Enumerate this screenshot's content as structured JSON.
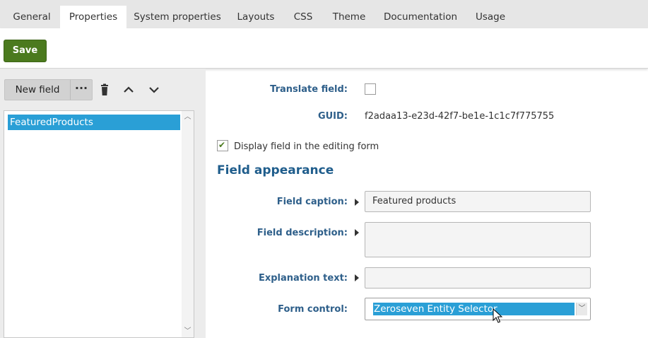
{
  "tabs": [
    {
      "label": "General",
      "active": false
    },
    {
      "label": "Properties",
      "active": true
    },
    {
      "label": "System properties",
      "active": false
    },
    {
      "label": "Layouts",
      "active": false
    },
    {
      "label": "CSS",
      "active": false
    },
    {
      "label": "Theme",
      "active": false
    },
    {
      "label": "Documentation",
      "active": false
    },
    {
      "label": "Usage",
      "active": false
    }
  ],
  "actions": {
    "save_label": "Save"
  },
  "left_panel": {
    "new_field_label": "New field",
    "more_label": "···",
    "fields": [
      {
        "name": "FeaturedProducts",
        "selected": true
      }
    ]
  },
  "form": {
    "translate_field": {
      "label": "Translate field:",
      "checked": false
    },
    "guid": {
      "label": "GUID:",
      "value": "f2adaa13-e23d-42f7-be1e-1c1c7f775755"
    },
    "display_field": {
      "label": "Display field in the editing form",
      "checked": true
    },
    "section_title": "Field appearance",
    "field_caption": {
      "label": "Field caption:",
      "value": "Featured products"
    },
    "field_description": {
      "label": "Field description:",
      "value": ""
    },
    "explanation_text": {
      "label": "Explanation text:",
      "value": ""
    },
    "form_control": {
      "label": "Form control:",
      "value": "Zeroseven Entity Selector"
    }
  },
  "colors": {
    "save_button": "#4b7a1e",
    "selection": "#2a9fd6",
    "label": "#2e5f8a",
    "section_title": "#1f5d8c"
  },
  "icons": [
    "trash-icon",
    "chevron-up-icon",
    "chevron-down-icon",
    "caret-right-icon",
    "checkmark-icon",
    "mouse-cursor-icon"
  ]
}
